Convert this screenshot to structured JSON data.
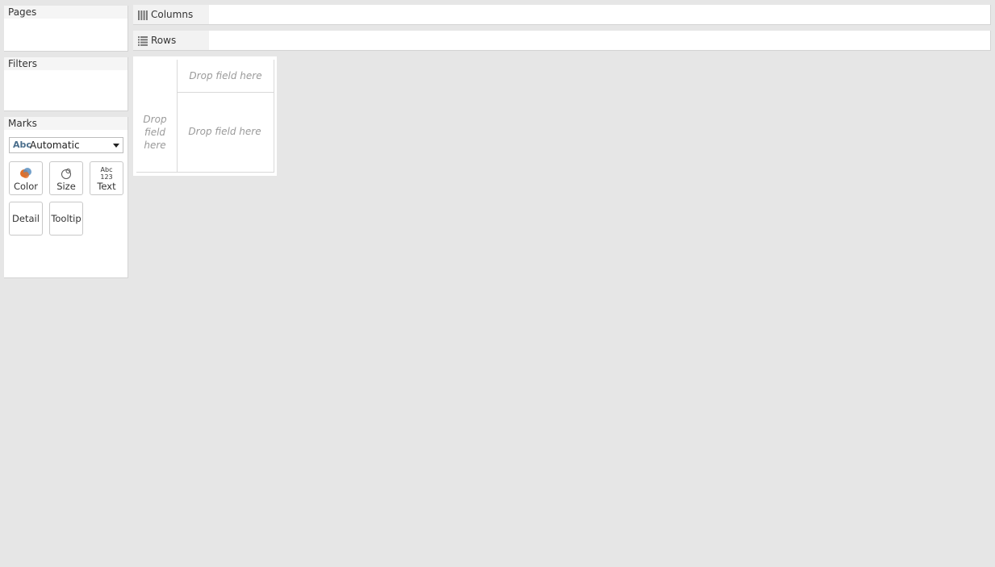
{
  "cards": {
    "pages": {
      "title": "Pages"
    },
    "filters": {
      "title": "Filters"
    },
    "marks": {
      "title": "Marks",
      "mark_type": {
        "badge": "Abc",
        "value": "Automatic"
      },
      "buttons": [
        {
          "label": "Color",
          "icon": "color-icon"
        },
        {
          "label": "Size",
          "icon": "size-icon"
        },
        {
          "label": "Text",
          "icon": "text-icon"
        },
        {
          "label": "Detail",
          "icon": ""
        },
        {
          "label": "Tooltip",
          "icon": ""
        }
      ],
      "text_icon_lines": [
        "Abc",
        "123"
      ]
    }
  },
  "shelves": {
    "columns": {
      "label": "Columns"
    },
    "rows": {
      "label": "Rows"
    }
  },
  "view": {
    "drop_column_header": "Drop field here",
    "drop_row_header_lines": [
      "Drop",
      "field",
      "here"
    ],
    "drop_main": "Drop field here"
  },
  "colors": {
    "background": "#e6e6e6",
    "card_header": "#f5f5f5",
    "accent_blue": "#4a6e8c",
    "color_orange": "#e0702a",
    "color_blue": "#5b8fc1",
    "placeholder_text": "#9a9a9a"
  }
}
